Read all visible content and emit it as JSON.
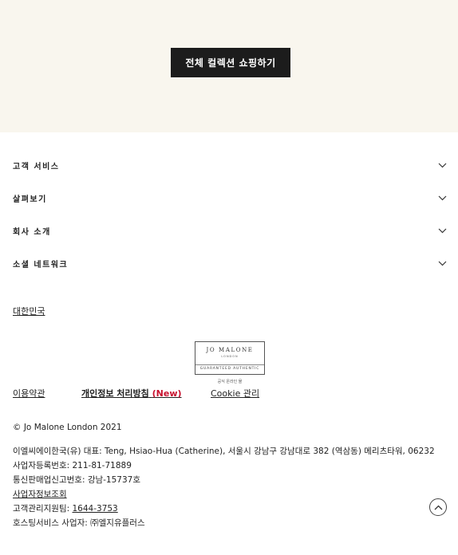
{
  "hero": {
    "button_label": "전체 컬렉션 쇼핑하기"
  },
  "accordion": [
    {
      "label": "고객 서비스"
    },
    {
      "label": "살펴보기"
    },
    {
      "label": "회사 소개"
    },
    {
      "label": "소셜 네트워크"
    }
  ],
  "country": {
    "label": "대한민국"
  },
  "badge": {
    "title": "JO MALONE",
    "subtitle": "LONDON",
    "auth": "GUARANTEED AUTHENTIC",
    "caption": "공식 온라인 몰"
  },
  "legal": {
    "terms": "이용약관",
    "privacy": "개인정보 처리방침",
    "privacy_new": "(New)",
    "cookie": "Cookie 관리"
  },
  "copyright": "© Jo Malone London 2021",
  "company": {
    "line1": "이엘씨에이한국(유) 대표: Teng, Hsiao-Hua (Catherine), 서울시 강남구 강남대로 382 (역삼동) 메리츠타워, 06232",
    "line2": "사업자등록번호: 211-81-71889",
    "line3": "통신판매업신고번호: 강남-15737호",
    "lookup_link": "사업자정보조회",
    "support_label": "고객관리지원팀: ",
    "support_phone": "1644-3753",
    "hosting": "호스팅서비스 사업자: ㈜엘지유플러스"
  }
}
